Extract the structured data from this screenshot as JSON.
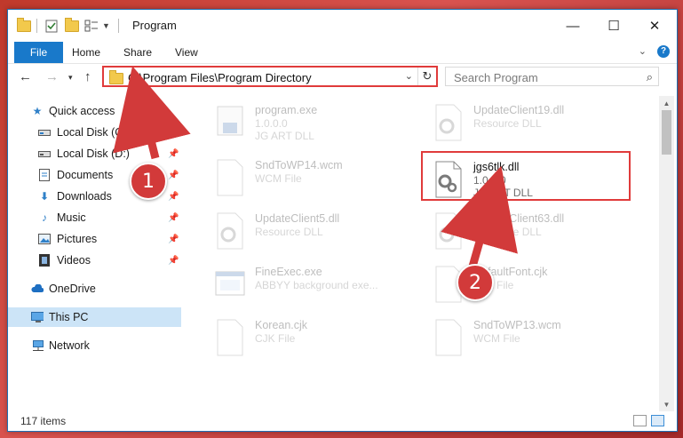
{
  "window": {
    "title": "Program",
    "controls": {
      "minimize": "—",
      "maximize": "☐",
      "close": "✕"
    }
  },
  "ribbon": {
    "file_tab": "File",
    "tabs": [
      "Home",
      "Share",
      "View"
    ],
    "help": "?"
  },
  "address": {
    "path": "C:\\Program Files\\Program Directory",
    "search_placeholder": "Search Program"
  },
  "sidebar": {
    "items": [
      {
        "label": "Quick access",
        "icon": "star-icon",
        "pinned": false
      },
      {
        "label": "Local Disk (C:)",
        "icon": "drive-icon",
        "pinned": true
      },
      {
        "label": "Local Disk (D:)",
        "icon": "drive-icon",
        "pinned": true
      },
      {
        "label": "Documents",
        "icon": "documents-icon",
        "pinned": true
      },
      {
        "label": "Downloads",
        "icon": "download-icon",
        "pinned": true
      },
      {
        "label": "Music",
        "icon": "music-icon",
        "pinned": true
      },
      {
        "label": "Pictures",
        "icon": "pictures-icon",
        "pinned": true
      },
      {
        "label": "Videos",
        "icon": "videos-icon",
        "pinned": true
      },
      {
        "label": "OneDrive",
        "icon": "cloud-icon",
        "pinned": false
      },
      {
        "label": "This PC",
        "icon": "computer-icon",
        "pinned": false,
        "selected": true
      },
      {
        "label": "Network",
        "icon": "network-icon",
        "pinned": false
      }
    ]
  },
  "files": [
    {
      "name": "program.exe",
      "line2": "1.0.0.0",
      "line3": "JG ART DLL",
      "icon": "exe-icon"
    },
    {
      "name": "UpdateClient19.dll",
      "line2": "Resource DLL",
      "line3": "",
      "icon": "dll-gear-icon"
    },
    {
      "name": "SndToWP14.wcm",
      "line2": "WCM File",
      "line3": "",
      "icon": "blank-file-icon"
    },
    {
      "name": "jgs6tlk.dll",
      "line2": "1.0.0.0",
      "line3": "JG ART DLL",
      "icon": "dll-gear-icon",
      "highlighted": true
    },
    {
      "name": "UpdateClient5.dll",
      "line2": "Resource DLL",
      "line3": "",
      "icon": "dll-gear-icon"
    },
    {
      "name": "UpdateClient63.dll",
      "line2": "Resource DLL",
      "line3": "",
      "icon": "dll-gear-icon"
    },
    {
      "name": "FineExec.exe",
      "line2": "ABBYY background exe...",
      "line3": "",
      "icon": "window-exe-icon"
    },
    {
      "name": "DefaultFont.cjk",
      "line2": "CJK File",
      "line3": "",
      "icon": "blank-file-icon"
    },
    {
      "name": "Korean.cjk",
      "line2": "CJK File",
      "line3": "",
      "icon": "blank-file-icon"
    },
    {
      "name": "SndToWP13.wcm",
      "line2": "WCM File",
      "line3": "",
      "icon": "blank-file-icon"
    }
  ],
  "status": {
    "item_count": "117 items"
  },
  "callouts": [
    "1",
    "2"
  ],
  "colors": {
    "accent": "#1979ca",
    "highlight": "#e03b3b",
    "selection": "#cce4f7",
    "folder": "#f2c94c"
  }
}
